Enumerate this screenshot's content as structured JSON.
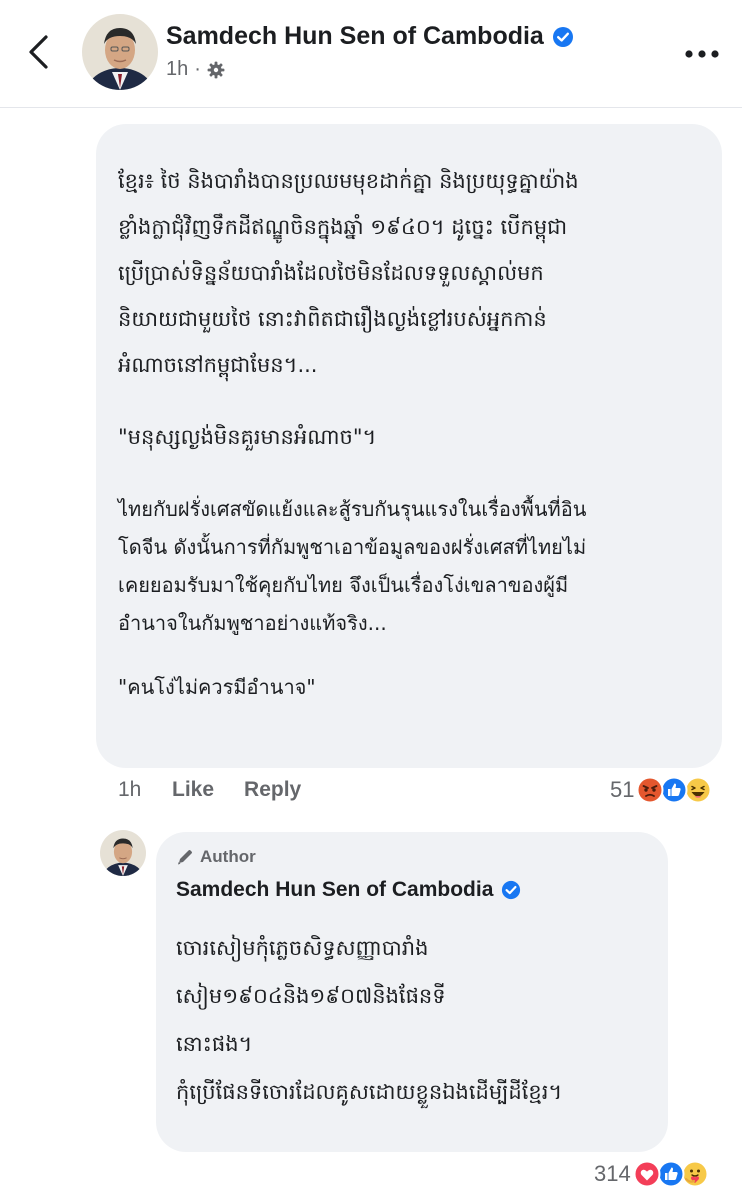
{
  "header": {
    "page_name": "Samdech Hun Sen of Cambodia",
    "time": "1h",
    "dot": "·"
  },
  "comment": {
    "khmer_lines": [
      "ខ្មែរ៖ ថៃ និងបារាំងបានប្រឈមមុខដាក់គ្នា និងប្រយុទ្ធគ្នាយ៉ាង",
      "ខ្លាំងក្លាជុំវិញទឹកដីឥណ្ឌូចិនក្នុងឆ្នាំ ១៩៤០។ ដូច្នេះ បើកម្ពុជា",
      "ប្រើប្រាស់ទិន្នន័យបារាំងដែលថៃមិនដែលទទួលស្គាល់មក",
      "និយាយជាមួយថៃ នោះវាពិតជារឿងល្ងង់ខ្លៅរបស់អ្នកកាន់",
      "អំណាចនៅកម្ពុជាមែន។..."
    ],
    "khmer_quote": "\"មនុស្សល្ងង់មិនគួរមានអំណាច\"។",
    "thai_lines": [
      "ไทยกับฝรั่งเศสขัดแย้งและสู้รบกันรุนแรงในเรื่องพื้นที่อิน",
      "โดจีน ดังนั้นการที่กัมพูชาเอาข้อมูลของฝรั่งเศสที่ไทยไม่",
      "เคยยอมรับมาใช้คุยกับไทย จึงเป็นเรื่องโง่เขลาของผู้มี",
      "อำนาจในกัมพูชาอย่างแท้จริง..."
    ],
    "thai_quote": "\"คนโง่ไม่ควรมีอำนาจ\"",
    "time": "1h",
    "like_label": "Like",
    "reply_label": "Reply",
    "reaction_count": "51",
    "reaction_icons": [
      "angry-icon",
      "like-icon",
      "haha-icon"
    ]
  },
  "reply": {
    "badge": "Author",
    "name": "Samdech Hun Sen of Cambodia",
    "lines": [
      "ចោរសៀមកុំភ្លេចសិទ្ធសញ្ញាបារាំង",
      "សៀម១៩០៤និង១៩០៧និងផែនទី",
      "នោះផង។",
      "កុំប្រើផែនទីចោរដែលគូសដោយខ្លួនឯងដើម្បីដីខ្មែរ។"
    ],
    "reaction_count": "314",
    "reaction_icons": [
      "love-icon",
      "like-icon",
      "care-icon"
    ]
  },
  "colors": {
    "brand_blue": "#1877f2",
    "bubble_bg": "#f0f2f5",
    "meta_gray": "#65676b",
    "text": "#1c1e21"
  }
}
